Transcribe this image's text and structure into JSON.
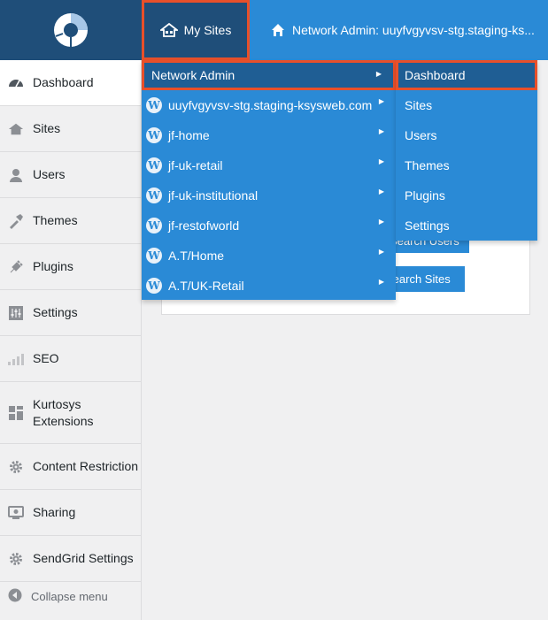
{
  "adminbar": {
    "logo_icon": "multisite-logo-icon",
    "my_sites_label": "My Sites",
    "network_admin_label": "Network Admin: uuyfvgyvsv-stg.staging-ks..."
  },
  "sidebar": {
    "items": [
      {
        "label": "Dashboard",
        "icon": "dashboard-icon"
      },
      {
        "label": "Sites",
        "icon": "sites-icon"
      },
      {
        "label": "Users",
        "icon": "users-icon"
      },
      {
        "label": "Themes",
        "icon": "themes-icon"
      },
      {
        "label": "Plugins",
        "icon": "plugins-icon"
      },
      {
        "label": "Settings",
        "icon": "settings-icon"
      },
      {
        "label": "SEO",
        "icon": "seo-icon"
      },
      {
        "label": "Kurtosys Extensions",
        "icon": "extensions-icon"
      },
      {
        "label": "Content Restriction",
        "icon": "gear-icon"
      },
      {
        "label": "Sharing",
        "icon": "sharing-icon"
      },
      {
        "label": "SendGrid Settings",
        "icon": "gear-icon"
      }
    ],
    "collapse_label": "Collapse menu"
  },
  "main": {
    "search_users_label": "Search Users",
    "search_sites_label": "Search Sites"
  },
  "flyout": {
    "header": "Network Admin",
    "sites": [
      "uuyfvgyvsv-stg.staging-ksysweb.com",
      "jf-home",
      "jf-uk-retail",
      "jf-uk-institutional",
      "jf-restofworld",
      "A.T/Home",
      "A.T/UK-Retail"
    ]
  },
  "submenu": {
    "items": [
      "Dashboard",
      "Sites",
      "Users",
      "Themes",
      "Plugins",
      "Settings"
    ]
  },
  "colors": {
    "bar_blue": "#2a8ad6",
    "dark_blue": "#1f4e79",
    "highlight": "#e8502a"
  }
}
